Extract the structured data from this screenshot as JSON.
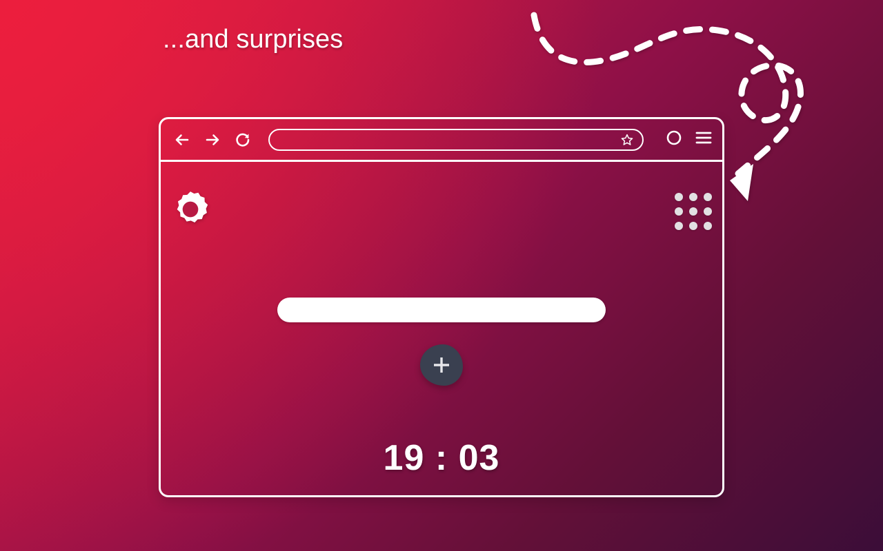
{
  "slide": {
    "headline": "...and surprises",
    "background": {
      "from": "#e02040",
      "mid": "#8e1047",
      "to": "#3b0d38"
    }
  },
  "annotation": {
    "arrow_name": "dashed-curved-arrow",
    "points_at": "apps-grid-icon",
    "color": "#ffffff"
  },
  "browser": {
    "chrome": {
      "back_icon": "arrow-left-icon",
      "forward_icon": "arrow-right-icon",
      "reload_icon": "reload-icon",
      "bookmark_icon": "star-icon",
      "profile_icon": "profile-circle-icon",
      "menu_icon": "hamburger-menu-icon",
      "url_value": "",
      "url_placeholder": ""
    },
    "newtab": {
      "settings_icon": "gear-icon",
      "apps_icon": "apps-grid-icon",
      "search_value": "",
      "search_placeholder": "",
      "add_shortcut_icon": "plus-icon",
      "add_shortcut_label": "+",
      "add_button_color": "#3a4050",
      "clock": "19 : 03"
    }
  }
}
